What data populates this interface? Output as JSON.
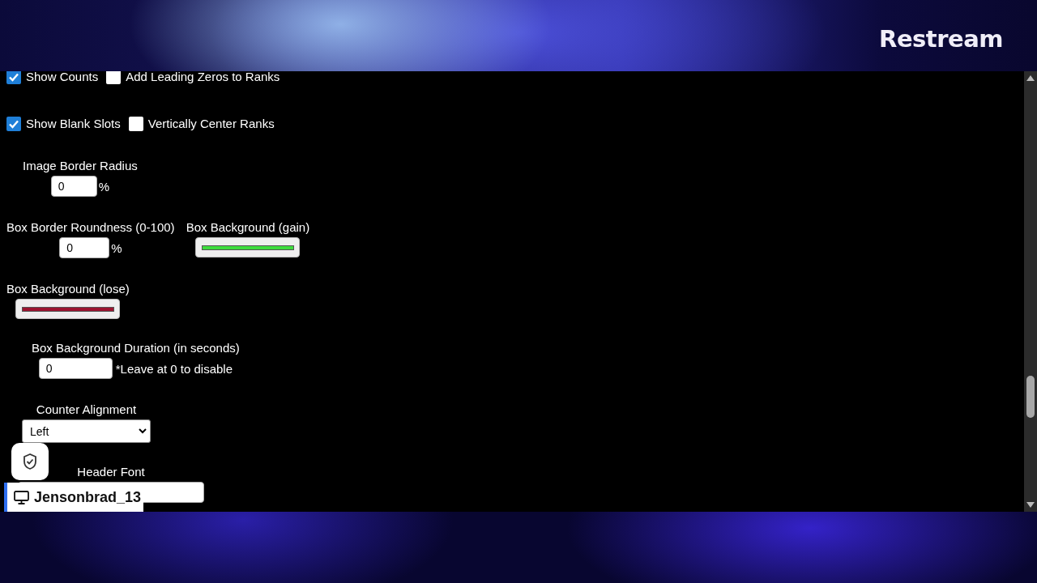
{
  "brand": "Restream",
  "rows": [
    {
      "items": [
        {
          "kind": "checkbox",
          "label": "Show Counts",
          "checked": true
        },
        {
          "kind": "checkbox",
          "label": "Add Leading Zeros to Ranks",
          "checked": false
        }
      ]
    },
    {
      "items": [
        {
          "kind": "checkbox",
          "label": "Show Blank Slots",
          "checked": true
        },
        {
          "kind": "checkbox",
          "label": "Vertically Center Ranks",
          "checked": false
        }
      ]
    },
    {
      "items": [
        {
          "kind": "number",
          "label": "Image Border Radius",
          "value": "0",
          "suffix": "%"
        }
      ]
    },
    {
      "items": [
        {
          "kind": "number",
          "label": "Box Border Roundness (0-100)",
          "value": "0",
          "suffix": "%"
        },
        {
          "kind": "color",
          "label": "Box Background (gain)",
          "color": "#3ddc3d"
        }
      ]
    },
    {
      "items": [
        {
          "kind": "color",
          "label": "Box Background (lose)",
          "color": "#9c1530"
        }
      ]
    },
    {
      "items": [
        {
          "kind": "number",
          "label": "Box Background Duration (in seconds)",
          "value": "0",
          "suffix": "*Leave at 0 to disable"
        }
      ]
    },
    {
      "items": [
        {
          "kind": "select",
          "label": "Counter Alignment",
          "value": "Left"
        }
      ]
    },
    {
      "items": [
        {
          "kind": "text",
          "label": "Header Font"
        }
      ]
    }
  ],
  "streamer_tag": {
    "name": "Jensonbrad_13"
  }
}
